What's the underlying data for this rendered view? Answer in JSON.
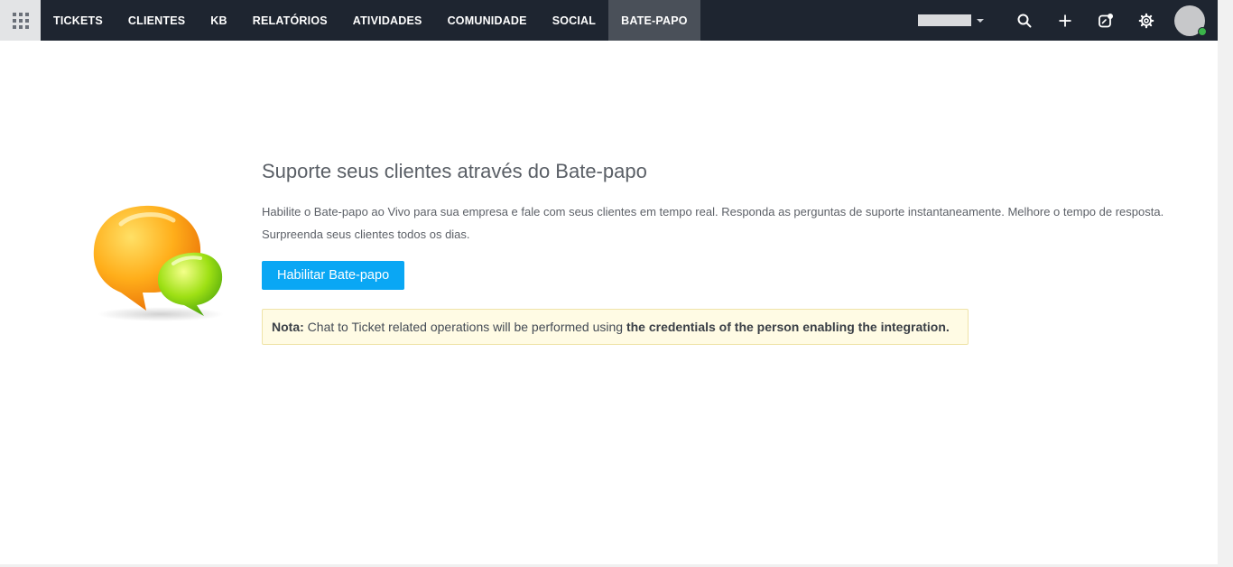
{
  "nav": {
    "items": [
      "TICKETS",
      "CLIENTES",
      "KB",
      "RELATÓRIOS",
      "ATIVIDADES",
      "COMUNIDADE",
      "SOCIAL",
      "BATE-PAPO"
    ],
    "active": "BATE-PAPO"
  },
  "header_tools": {
    "icons": [
      "apps-grid-icon",
      "search-icon",
      "plus-icon",
      "compose-icon",
      "gear-icon",
      "avatar"
    ]
  },
  "main": {
    "title": "Suporte seus clientes através do Bate-papo",
    "description": "Habilite o Bate-papo ao Vivo para sua empresa e fale com seus clientes em tempo real. Responda as perguntas de suporte instantaneamente. Melhore o tempo de resposta. Surpreenda seus clientes todos os dias.",
    "enable_button": "Habilitar Bate-papo",
    "note_label": "Nota:",
    "note_text": "Chat to Ticket related operations will be performed using",
    "note_bold": "the credentials of the person enabling the integration."
  },
  "colors": {
    "topbar": "#1e2530",
    "active_tab": "#4a5059",
    "primary_button": "#0aa7f4",
    "note_background": "#fffbe4",
    "online_status": "#3bb54a"
  }
}
